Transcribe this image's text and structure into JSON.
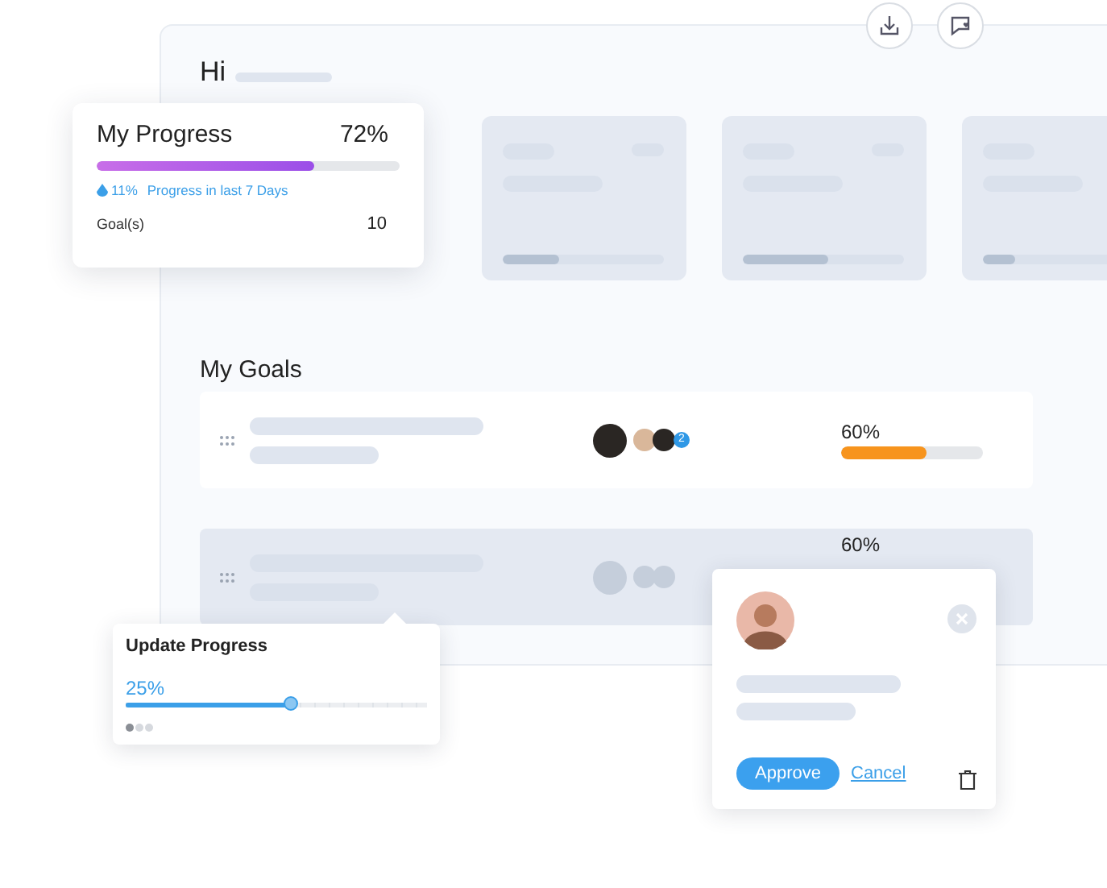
{
  "header": {
    "greeting": "Hi"
  },
  "progress_card": {
    "title": "My Progress",
    "percent": "72%",
    "level": 0.72,
    "trend": "11%",
    "trend_label": "Progress in last 7 Days",
    "goals_label": "Goal(s)",
    "goals_count": "10"
  },
  "summary_cards": [
    {
      "level": 0.35
    },
    {
      "level": 0.53
    },
    {
      "level": 0.2
    }
  ],
  "goals": {
    "title": "My Goals",
    "rows": [
      {
        "kind": "filled",
        "selected": false,
        "percent": "60%",
        "level": 0.6,
        "extra_count": "2"
      },
      {
        "kind": "skeleton",
        "selected": true,
        "percent": "60%"
      }
    ]
  },
  "update_popover": {
    "title": "Update Progress",
    "value": "25%",
    "level": 0.55,
    "pages": [
      {
        "selected": true
      },
      {
        "selected": false
      },
      {
        "selected": false
      }
    ]
  },
  "approval_popover": {
    "approve": "Approve",
    "cancel": "Cancel"
  }
}
